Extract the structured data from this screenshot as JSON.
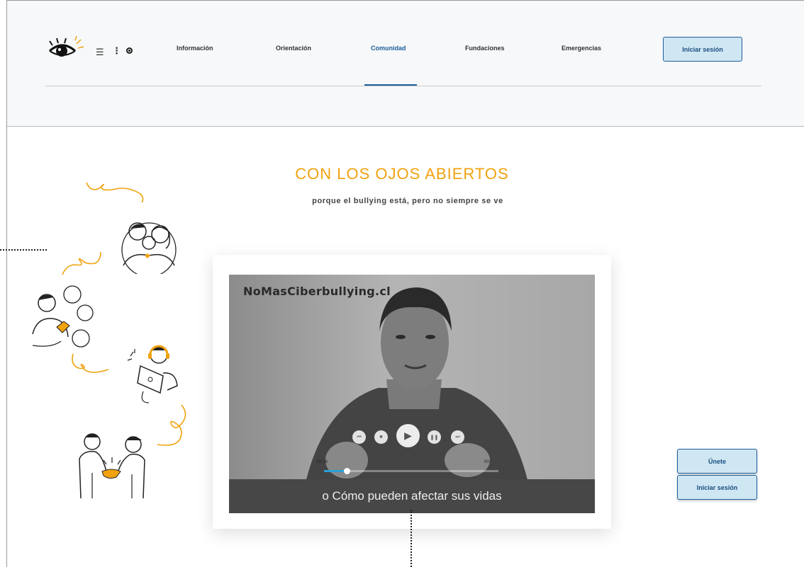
{
  "header": {
    "logo": "eye-logo-icon",
    "menu_icon": "☰",
    "more_icon": "⋮",
    "nav": [
      {
        "label": "Información",
        "active": false
      },
      {
        "label": "Orientación",
        "active": false
      },
      {
        "label": "Comunidad",
        "active": true
      },
      {
        "label": "Fundaciones",
        "active": false
      },
      {
        "label": "Emergencias",
        "active": false
      }
    ],
    "login_label": "Iniciar sesión"
  },
  "hero": {
    "title": "CON LOS OJOS ABIERTOS",
    "subtitle": "porque el bullying está, pero no siempre se ve"
  },
  "video": {
    "watermark": "NoMasCiberbullying.cl",
    "caption": "o Cómo pueden afectar sus vidas",
    "time_current": "00:16",
    "time_total": "00:",
    "progress": 0.13
  },
  "side": {
    "join_label": "Únete",
    "login_label": "Iniciar sesión"
  },
  "colors": {
    "accent_orange": "#f0a20f",
    "brand_blue": "#1b5f9b",
    "button_fill": "#cfe6f3"
  }
}
